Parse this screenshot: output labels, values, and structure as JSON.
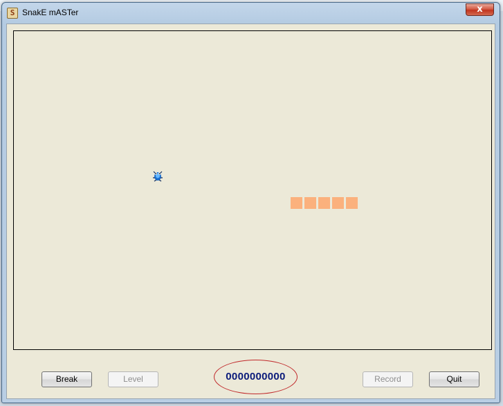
{
  "window": {
    "title": "SnakE mASTer",
    "close_glyph": "x",
    "icon": "app-icon"
  },
  "game": {
    "snake_length": 5,
    "colors": {
      "snake": "#fbb17d",
      "board": "#ece9d8",
      "food": "#1a6fd0"
    },
    "food_icon": "bug-icon"
  },
  "controls": {
    "break_label": "Break",
    "level_label": "Level",
    "score": "0000000000",
    "record_label": "Record",
    "quit_label": "Quit"
  }
}
